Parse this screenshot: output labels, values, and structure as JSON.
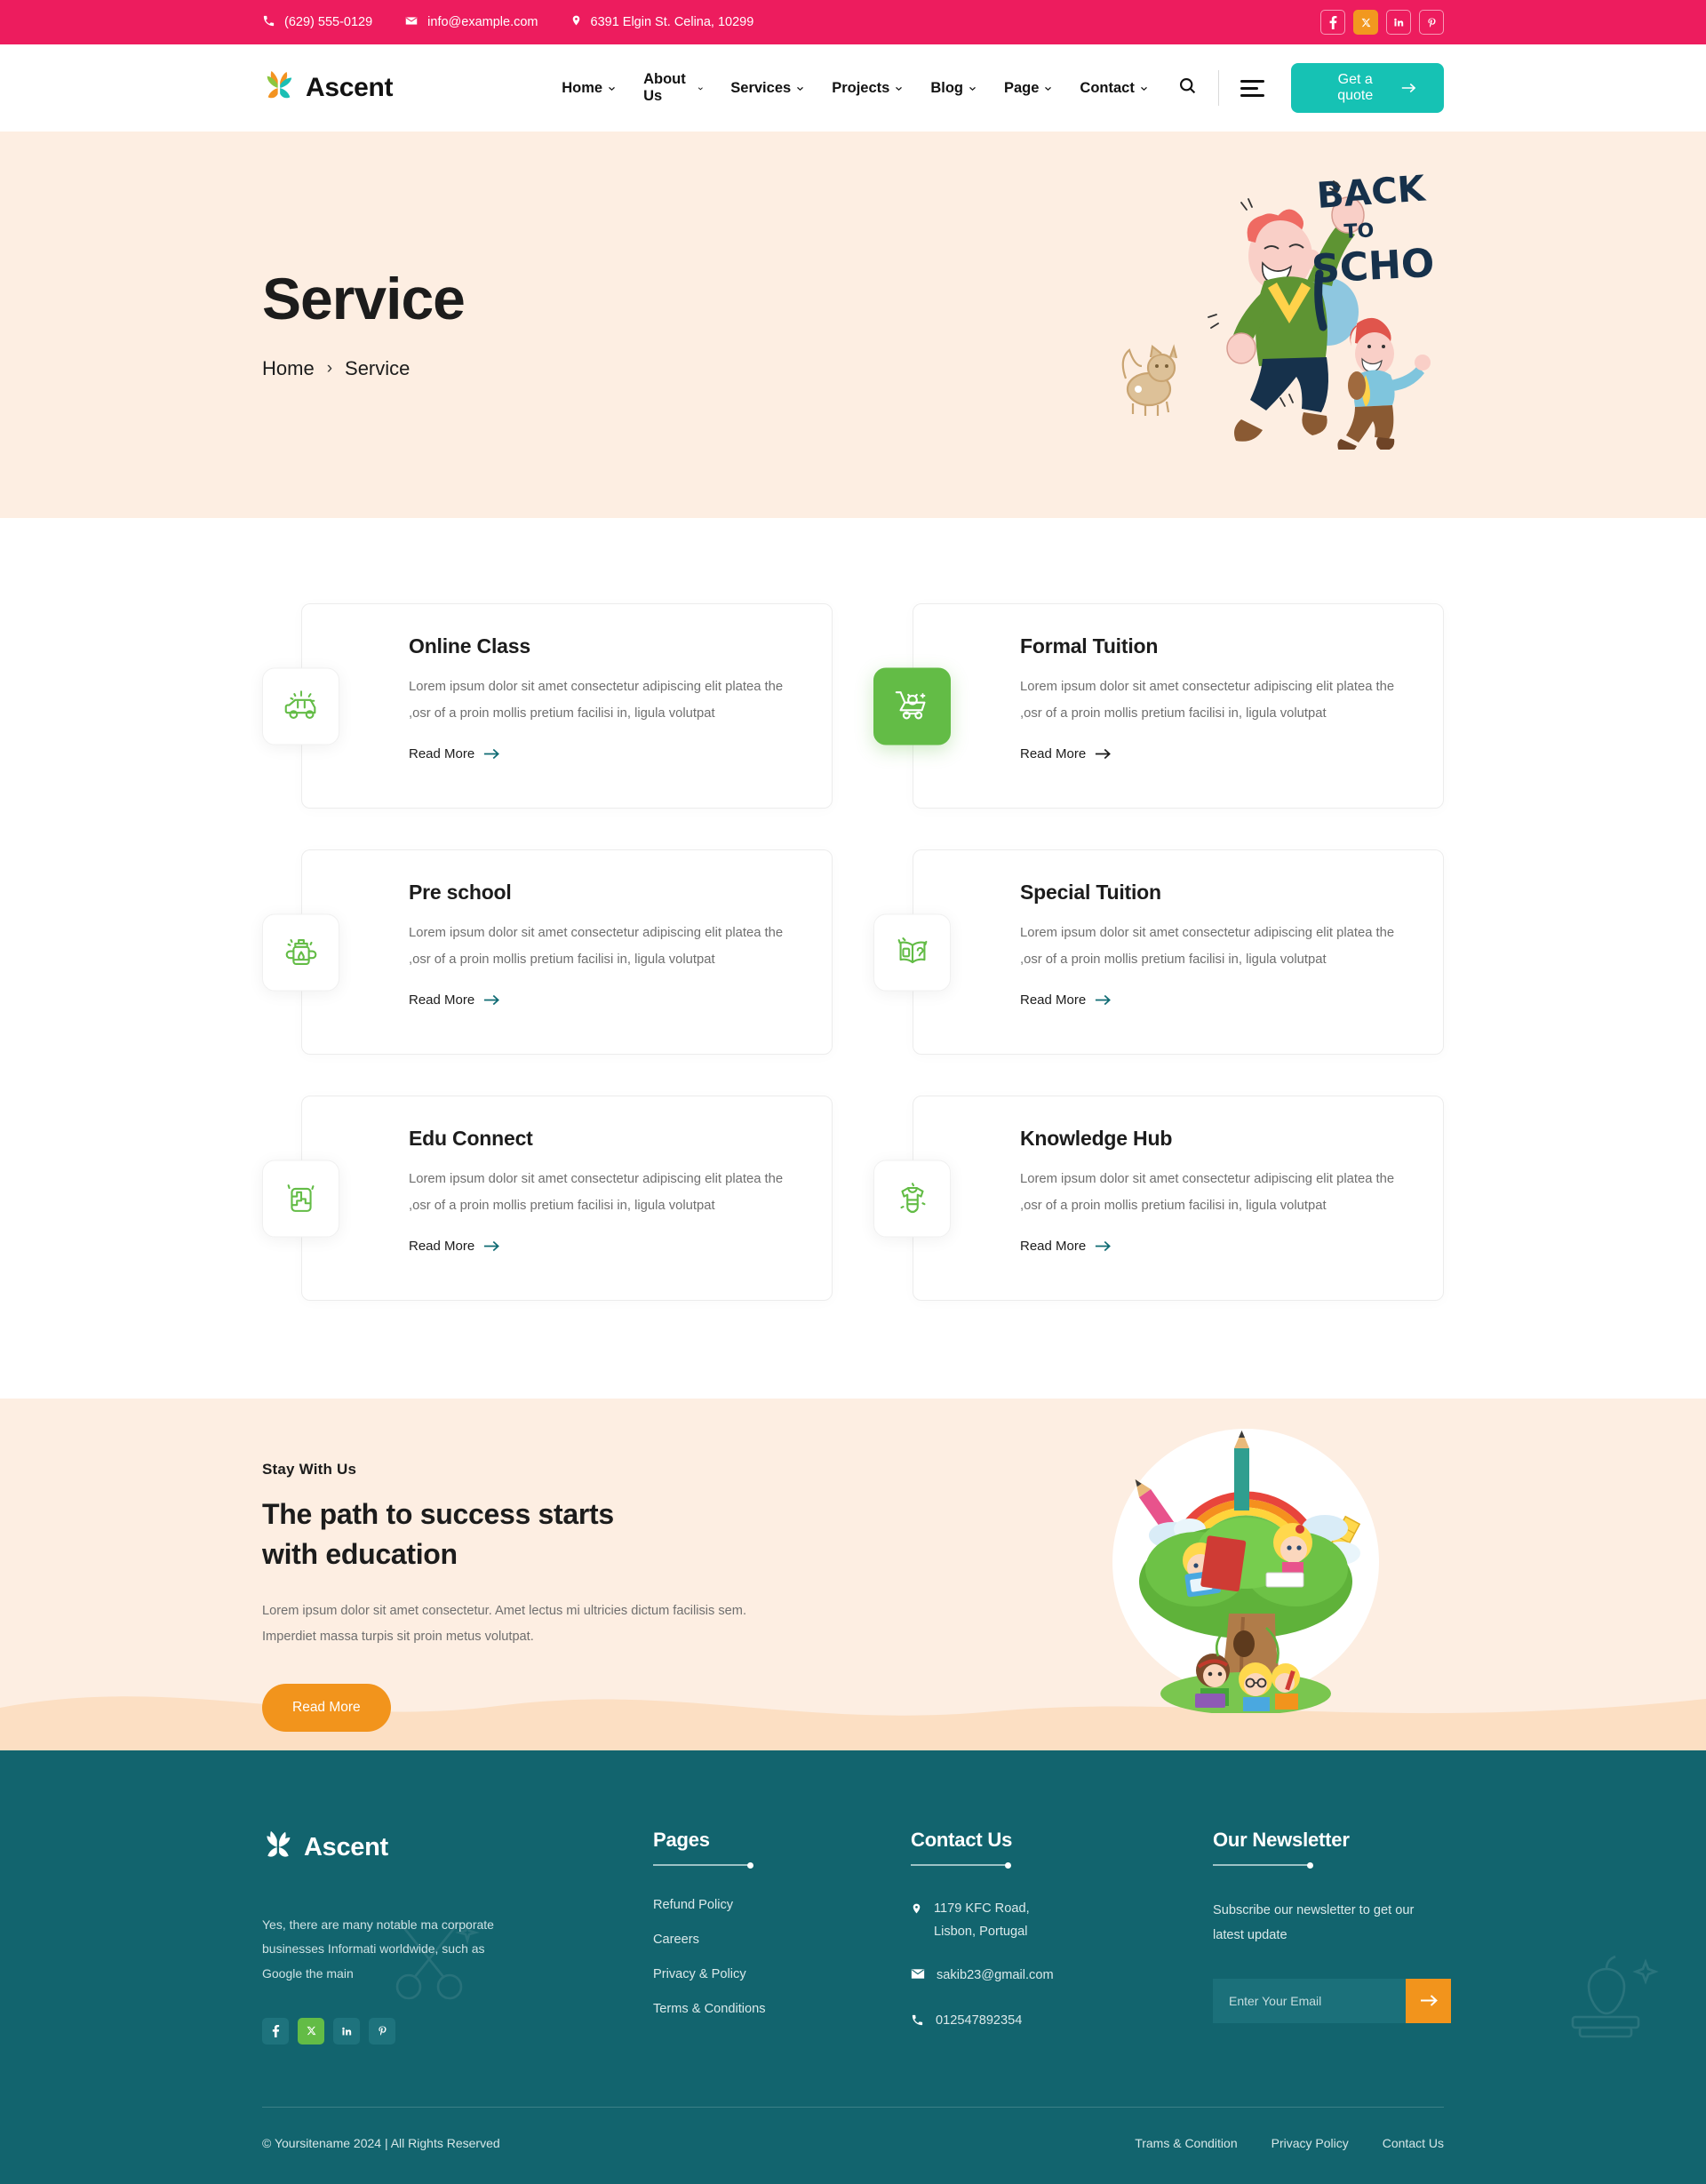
{
  "topbar": {
    "phone": "(629) 555-0129",
    "email": "info@example.com",
    "address": "6391 Elgin St. Celina, 10299",
    "bg_color": "#ed1c5e",
    "socials": [
      {
        "name": "facebook",
        "glyph": "f",
        "active": false
      },
      {
        "name": "x-twitter",
        "glyph": "X",
        "active": true
      },
      {
        "name": "linkedin",
        "glyph": "in",
        "active": false
      },
      {
        "name": "pinterest",
        "glyph": "P",
        "active": false
      }
    ]
  },
  "nav": {
    "brand": "Ascent",
    "items": [
      {
        "label": "Home",
        "caret": true
      },
      {
        "label": "About Us",
        "caret": true
      },
      {
        "label": "Services",
        "caret": true
      },
      {
        "label": "Projects",
        "caret": true
      },
      {
        "label": "Blog",
        "caret": true
      },
      {
        "label": "Page",
        "caret": true
      },
      {
        "label": "Contact",
        "caret": true
      }
    ],
    "quote_label": "Get a quote",
    "quote_color": "#16c2b4"
  },
  "hero": {
    "title": "Service",
    "breadcrumb": {
      "home": "Home",
      "sep": "›",
      "current": "Service"
    },
    "art_text_line1": "BACK",
    "art_text_line2": "TO",
    "art_text_line3": "SCHOOL",
    "bg_color": "#fdeee2"
  },
  "services": {
    "read_more": "Read More",
    "cards": [
      {
        "title": "Online Class",
        "body": "Lorem ipsum dolor sit amet consectetur adipiscing elit platea  the ,osr of a proin mollis pretium facilisi in, ligula volutpat",
        "icon": "car-sparkle-icon",
        "active": false
      },
      {
        "title": "Formal Tuition",
        "body": "Lorem ipsum dolor sit amet consectetur adipiscing elit platea  the ,osr of a proin mollis pretium facilisi in, ligula volutpat",
        "icon": "toy-cart-icon",
        "active": true
      },
      {
        "title": "Pre school",
        "body": "Lorem ipsum dolor sit amet consectetur adipiscing elit platea  the ,osr of a proin mollis pretium facilisi in, ligula volutpat",
        "icon": "sippy-cup-icon",
        "active": false
      },
      {
        "title": "Special Tuition",
        "body": "Lorem ipsum dolor sit amet consectetur adipiscing elit platea  the ,osr of a proin mollis pretium facilisi in, ligula volutpat",
        "icon": "open-book-icon",
        "active": false
      },
      {
        "title": "Edu Connect",
        "body": "Lorem ipsum dolor sit amet consectetur adipiscing elit platea  the ,osr of a proin mollis pretium facilisi in, ligula volutpat",
        "icon": "puzzle-icon",
        "active": false
      },
      {
        "title": "Knowledge Hub",
        "body": "Lorem ipsum dolor sit amet consectetur adipiscing elit platea  the ,osr of a proin mollis pretium facilisi in, ligula volutpat",
        "icon": "baby-onesie-icon",
        "active": false
      }
    ]
  },
  "cta": {
    "eyebrow": "Stay With Us",
    "heading_line1": "The path to success starts",
    "heading_line2": "with education",
    "body": "Lorem ipsum dolor sit amet consectetur. Amet lectus mi ultricies dictum facilisis sem. Imperdiet massa turpis sit proin metus volutpat.",
    "button": "Read More",
    "button_color": "#f2941c"
  },
  "footer": {
    "brand": "Ascent",
    "about": "Yes, there are many notable ma corporate businesses Informati worldwide, such as Google the main",
    "socials": [
      {
        "name": "facebook",
        "glyph": "f",
        "active": false
      },
      {
        "name": "x-twitter",
        "glyph": "X",
        "active": true
      },
      {
        "name": "linkedin",
        "glyph": "in",
        "active": false
      },
      {
        "name": "pinterest",
        "glyph": "P",
        "active": false
      }
    ],
    "pages": {
      "heading": "Pages",
      "links": [
        "Refund Policy",
        "Careers",
        "Privacy & Policy",
        "Terms & Conditions"
      ]
    },
    "contact": {
      "heading": "Contact Us",
      "address_line1": "1179 KFC Road,",
      "address_line2": "Lisbon, Portugal",
      "email": "sakib23@gmail.com",
      "phone": "012547892354"
    },
    "newsletter": {
      "heading": "Our Newsletter",
      "body": "Subscribe our newsletter to get our latest update",
      "placeholder": "Enter Your Email",
      "value": "",
      "button_color": "#f2941c"
    },
    "copyright": "© Yoursitename  2024 | All Rights Reserved",
    "bottom_links": [
      "Trams & Condition",
      "Privacy Policy",
      "Contact Us"
    ],
    "bg_color": "#12646e"
  }
}
